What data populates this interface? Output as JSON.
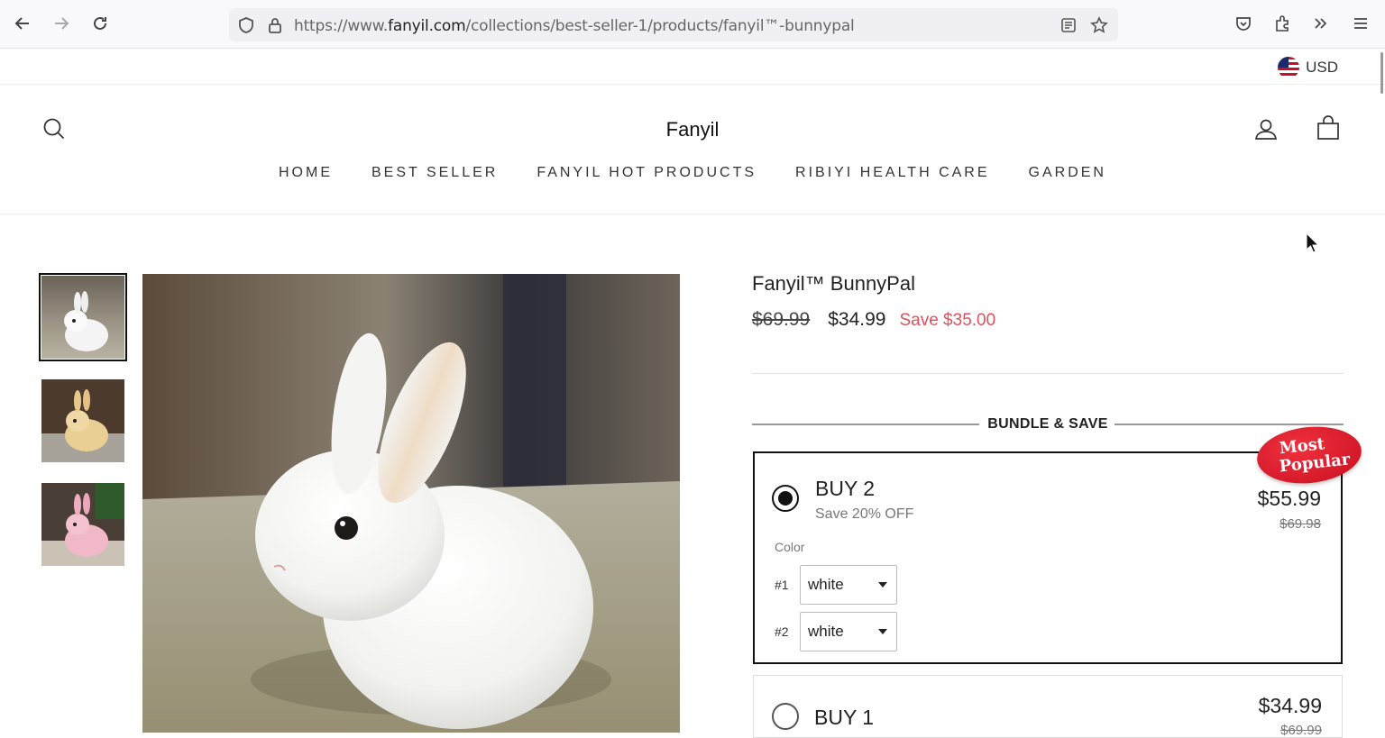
{
  "browser": {
    "url_prefix": "https://www.",
    "url_domain": "fanyil.com",
    "url_path": "/collections/best-seller-1/products/fanyil™-bunnypal"
  },
  "currency": {
    "label": "USD",
    "icon": "us-flag-icon"
  },
  "header": {
    "brand": "Fanyil",
    "nav": [
      "HOME",
      "BEST SELLER",
      "FANYIL HOT PRODUCTS",
      "RIBIYI HEALTH CARE",
      "GARDEN"
    ]
  },
  "product": {
    "title": "Fanyil™ BunnyPal",
    "compare_price": "$69.99",
    "price": "$34.99",
    "save_text": "Save $35.00",
    "bundle_heading": "BUNDLE & SAVE",
    "badge": {
      "line1": "Most",
      "line2": "Popular",
      "color": "#d8192a"
    },
    "offers": [
      {
        "title": "BUY 2",
        "subtitle": "Save 20% OFF",
        "price": "$55.99",
        "compare_price": "$69.98",
        "selected": true,
        "color_label": "Color",
        "variants": [
          {
            "num": "#1",
            "value": "white"
          },
          {
            "num": "#2",
            "value": "white"
          }
        ]
      },
      {
        "title": "BUY 1",
        "price": "$34.99",
        "compare_price": "$69.99",
        "selected": false
      }
    ]
  },
  "colors": {
    "sale": "#e0505a",
    "accent": "#111111"
  }
}
